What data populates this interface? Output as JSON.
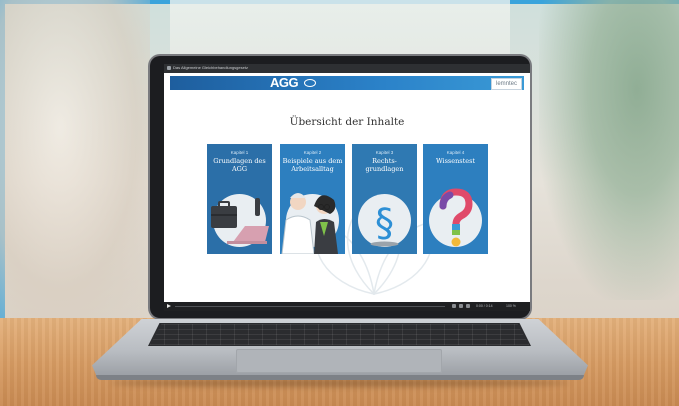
{
  "colors": {
    "accent": "#3aa4dc",
    "header_blue": "#2b82c9",
    "card_blue": "#2d7fbf"
  },
  "browser": {
    "tab_title": "Das Allgemeine Gleichbehandlungsgesetz"
  },
  "app": {
    "logo_text": "AGG",
    "brand": "lemntec"
  },
  "page": {
    "title": "Übersicht der Inhalte"
  },
  "cards": [
    {
      "kicker": "Kapitel 1",
      "title": "Grundlagen des AGG",
      "icon": "briefcase-laptop-icon"
    },
    {
      "kicker": "Kapitel 2",
      "title": "Beispiele aus dem Arbeitsalltag",
      "icon": "people-icon"
    },
    {
      "kicker": "Kapitel 3",
      "title": "Rechts-grundlagen",
      "icon": "paragraph-icon"
    },
    {
      "kicker": "Kapitel 4",
      "title": "Wissenstest",
      "icon": "question-mark-icon"
    }
  ],
  "player": {
    "progress": 0.0,
    "time": "0:00 / 0:14",
    "speed": "100 %"
  }
}
